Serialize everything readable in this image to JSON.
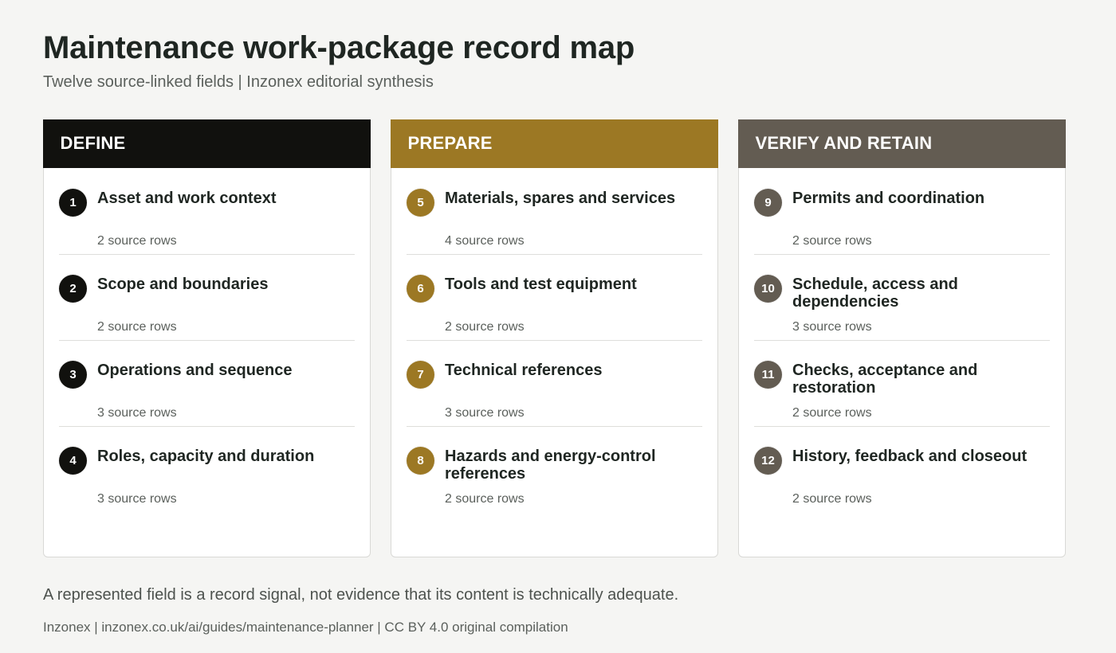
{
  "header": {
    "title": "Maintenance work-package record map",
    "subtitle": "Twelve source-linked fields | Inzonex editorial synthesis"
  },
  "columns": [
    {
      "label": "DEFINE",
      "color": "#11110e",
      "items": [
        {
          "num": "1",
          "title": "Asset and work context",
          "rows": "2 source rows"
        },
        {
          "num": "2",
          "title": "Scope and boundaries",
          "rows": "2 source rows"
        },
        {
          "num": "3",
          "title": "Operations and sequence",
          "rows": "3 source rows"
        },
        {
          "num": "4",
          "title": "Roles, capacity and duration",
          "rows": "3 source rows"
        }
      ]
    },
    {
      "label": "PREPARE",
      "color": "#9c7824",
      "items": [
        {
          "num": "5",
          "title": "Materials, spares and services",
          "rows": "4 source rows"
        },
        {
          "num": "6",
          "title": "Tools and test equipment",
          "rows": "2 source rows"
        },
        {
          "num": "7",
          "title": "Technical references",
          "rows": "3 source rows"
        },
        {
          "num": "8",
          "title": "Hazards and energy-control references",
          "rows": "2 source rows"
        }
      ]
    },
    {
      "label": "VERIFY AND RETAIN",
      "color": "#635c52",
      "items": [
        {
          "num": "9",
          "title": "Permits and coordination",
          "rows": "2 source rows"
        },
        {
          "num": "10",
          "title": "Schedule, access and dependencies",
          "rows": "3 source rows"
        },
        {
          "num": "11",
          "title": "Checks, acceptance and restoration",
          "rows": "2 source rows"
        },
        {
          "num": "12",
          "title": "History, feedback and closeout",
          "rows": "2 source rows"
        }
      ]
    }
  ],
  "note": "A represented field is a record signal, not evidence that its content is technically adequate.",
  "footer": "Inzonex | inzonex.co.uk/ai/guides/maintenance-planner | CC BY 4.0 original compilation"
}
